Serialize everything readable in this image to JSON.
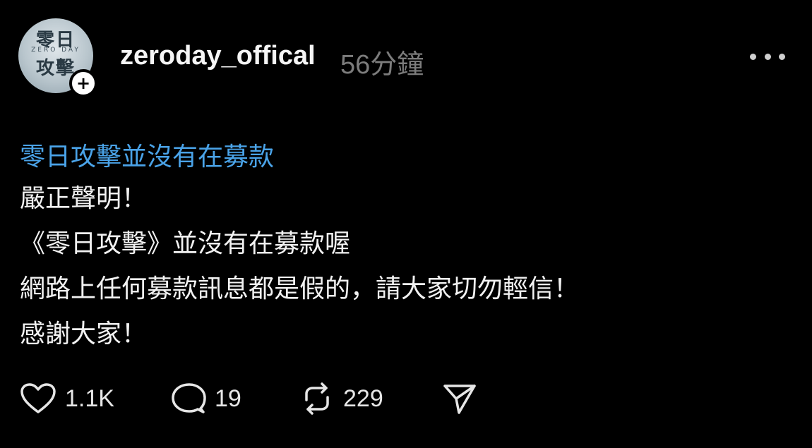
{
  "post": {
    "author": {
      "username": "zeroday_offical",
      "avatar_logo_top": "零日",
      "avatar_logo_mid": "ZERO DAY",
      "avatar_logo_bottom": "攻擊",
      "follow_label": "+"
    },
    "timestamp": "56分鐘",
    "tag": "零日攻擊並沒有在募款",
    "body_lines": [
      "嚴正聲明！",
      "《零日攻擊》並沒有在募款喔",
      "網路上任何募款訊息都是假的，請大家切勿輕信！",
      "感謝大家！"
    ],
    "actions": {
      "likes": "1.1K",
      "replies": "19",
      "reposts": "229"
    },
    "icons": {
      "like": "heart-icon",
      "reply": "comment-icon",
      "repost": "repost-icon",
      "share": "send-icon",
      "more": "more-icon"
    },
    "colors": {
      "background": "#000000",
      "tag": "#4aa3e8",
      "timestamp": "#7c7c7c",
      "text": "#f2f2f2"
    }
  }
}
